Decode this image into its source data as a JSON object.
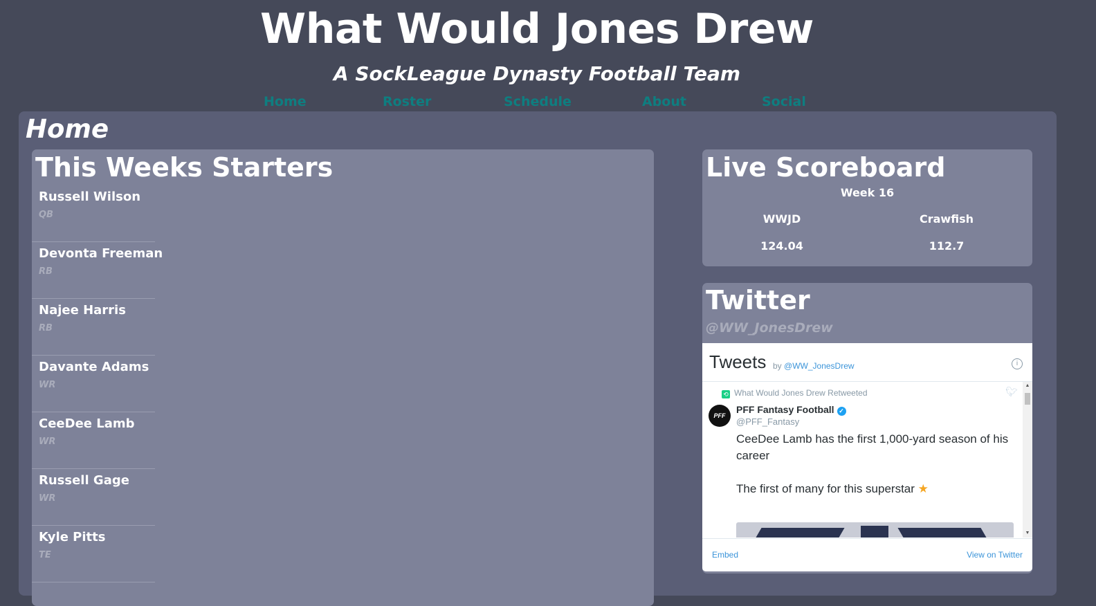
{
  "site": {
    "title": "What Would Jones Drew",
    "subtitle": "A SockLeague Dynasty Football Team"
  },
  "nav": {
    "items": [
      {
        "label": "Home"
      },
      {
        "label": "Roster"
      },
      {
        "label": "Schedule"
      },
      {
        "label": "About"
      },
      {
        "label": "Social"
      }
    ],
    "link_color": "#0e7e80"
  },
  "page": {
    "title": "Home"
  },
  "starters": {
    "title": "This Weeks Starters",
    "players": [
      {
        "name": "Russell Wilson",
        "position": "QB"
      },
      {
        "name": "Devonta Freeman",
        "position": "RB"
      },
      {
        "name": "Najee Harris",
        "position": "RB"
      },
      {
        "name": "Davante Adams",
        "position": "WR"
      },
      {
        "name": "CeeDee Lamb",
        "position": "WR"
      },
      {
        "name": "Russell Gage",
        "position": "WR"
      },
      {
        "name": "Kyle Pitts",
        "position": "TE"
      }
    ]
  },
  "scoreboard": {
    "title": "Live Scoreboard",
    "week": "Week 16",
    "home_team": "WWJD",
    "away_team": "Crawfish",
    "home_score": "124.04",
    "away_score": "112.7"
  },
  "twitter": {
    "title": "Twitter",
    "handle": "@WW_JonesDrew",
    "widget": {
      "title": "Tweets",
      "by_label": "by",
      "by_handle": "@WW_JonesDrew",
      "info_icon": "info-icon",
      "retweet_text": "What Would Jones Drew Retweeted",
      "tweet": {
        "author_name": "PFF Fantasy Football",
        "author_handle": "@PFF_Fantasy",
        "avatar_text": "PFF",
        "line1": "CeeDee Lamb has the first 1,000-yard season of his career",
        "line2": "The first of many for this superstar",
        "emoji": "★"
      },
      "embed_label": "Embed",
      "view_label": "View on Twitter"
    }
  },
  "colors": {
    "background": "#454959",
    "panel": "#5a5e76",
    "card": "#7e8299",
    "muted_text": "#a9acbb"
  }
}
